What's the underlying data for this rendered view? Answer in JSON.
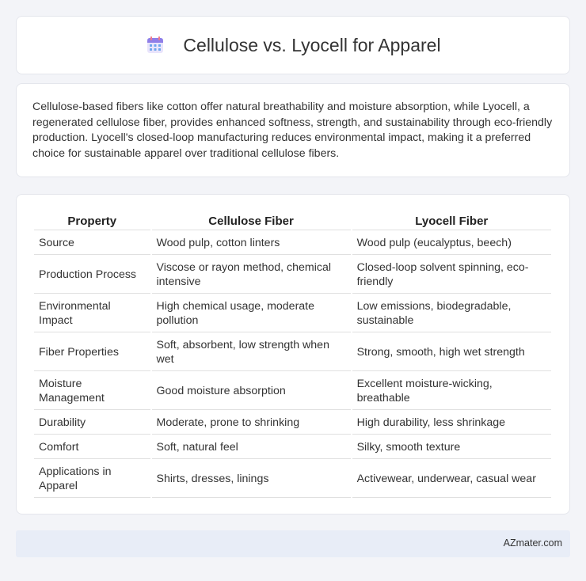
{
  "header": {
    "title": "Cellulose vs. Lyocell for Apparel",
    "icon": "calendar-icon"
  },
  "intro": {
    "text": "Cellulose-based fibers like cotton offer natural breathability and moisture absorption, while Lyocell, a regenerated cellulose fiber, provides enhanced softness, strength, and sustainability through eco-friendly production. Lyocell's closed-loop manufacturing reduces environmental impact, making it a preferred choice for sustainable apparel over traditional cellulose fibers."
  },
  "table": {
    "headers": [
      "Property",
      "Cellulose Fiber",
      "Lyocell Fiber"
    ],
    "rows": [
      [
        "Source",
        "Wood pulp, cotton linters",
        "Wood pulp (eucalyptus, beech)"
      ],
      [
        "Production Process",
        "Viscose or rayon method, chemical intensive",
        "Closed-loop solvent spinning, eco-friendly"
      ],
      [
        "Environmental Impact",
        "High chemical usage, moderate pollution",
        "Low emissions, biodegradable, sustainable"
      ],
      [
        "Fiber Properties",
        "Soft, absorbent, low strength when wet",
        "Strong, smooth, high wet strength"
      ],
      [
        "Moisture Management",
        "Good moisture absorption",
        "Excellent moisture-wicking, breathable"
      ],
      [
        "Durability",
        "Moderate, prone to shrinking",
        "High durability, less shrinkage"
      ],
      [
        "Comfort",
        "Soft, natural feel",
        "Silky, smooth texture"
      ],
      [
        "Applications in Apparel",
        "Shirts, dresses, linings",
        "Activewear, underwear, casual wear"
      ]
    ]
  },
  "footer": {
    "brand": "AZmater.com"
  }
}
